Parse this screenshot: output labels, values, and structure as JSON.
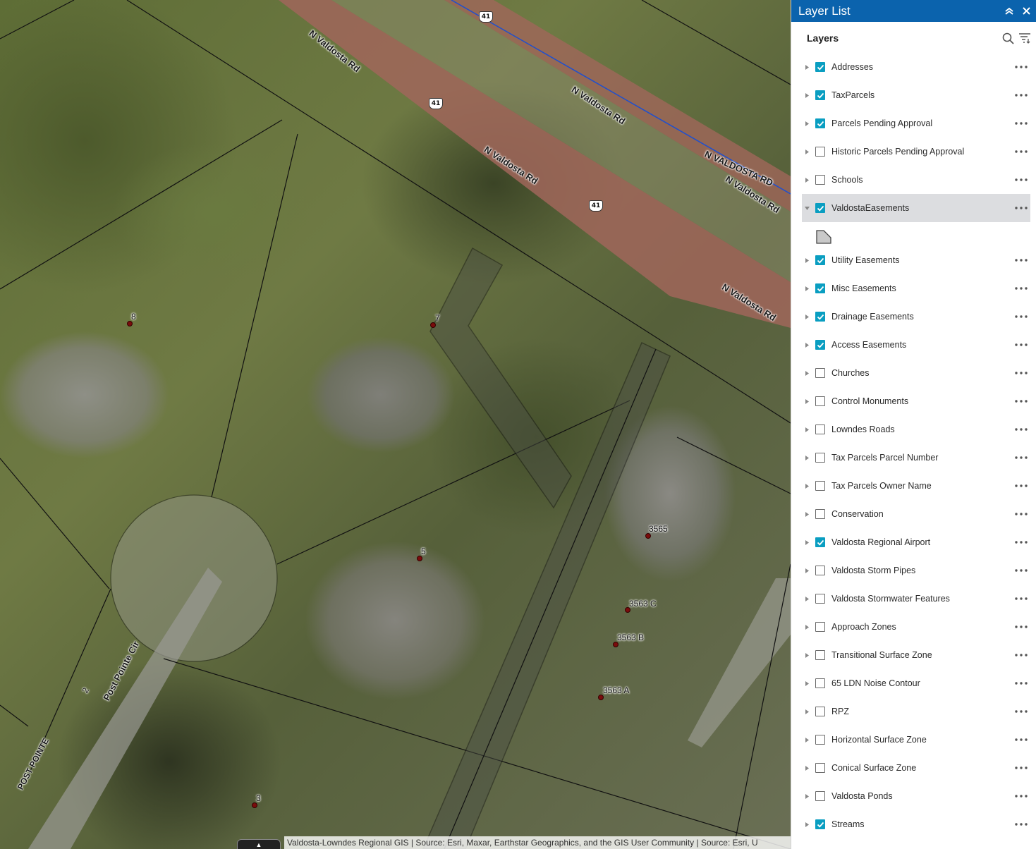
{
  "map": {
    "road_labels": {
      "n_valdosta_rd_1": "N Valdosta Rd",
      "n_valdosta_rd_2": "N Valdosta Rd",
      "n_valdosta_rd_3": "N Valdosta Rd",
      "n_valdosta_rd_4": "N Valdosta Rd",
      "n_valdosta_rd_caps": "N VALDOSTA RD",
      "n_valdosta_rd_5": "N Valdosta Rd",
      "post_pointe_cir": "Post Pointe Cir",
      "post_pointe": "POST POINTE"
    },
    "shields": [
      "41",
      "41",
      "41"
    ],
    "address_points": [
      "8",
      "7",
      "5",
      "3565",
      "3563 C",
      "3563 B",
      "3563 A",
      "3",
      "2"
    ],
    "attribution": "Valdosta-Lowndes Regional GIS | Source: Esri, Maxar, Earthstar Geographics, and the GIS User Community | Source: Esri, U",
    "colors": {
      "road_fill": "#a0665a",
      "parcel_line": "#111111",
      "easement_fill": "#4b4f44",
      "address_point": "#7a0c0c",
      "blue_line": "#1d4fd0"
    }
  },
  "panel": {
    "title": "Layer List",
    "collapse_icon": "double-chevron-up-icon",
    "close_icon": "close-icon",
    "layers_heading": "Layers",
    "search_icon": "search-icon",
    "filter_icon": "filter-icon",
    "accent_color": "#0b63ad",
    "checkbox_color": "#0a9ec1",
    "layers": [
      {
        "name": "Addresses",
        "checked": true
      },
      {
        "name": "TaxParcels",
        "checked": true
      },
      {
        "name": "Parcels Pending Approval",
        "checked": true
      },
      {
        "name": "Historic Parcels Pending Approval",
        "checked": false
      },
      {
        "name": "Schools",
        "checked": false
      },
      {
        "name": "ValdostaEasements",
        "checked": true,
        "expanded": true,
        "selected": true
      },
      {
        "name": "Utility Easements",
        "checked": true
      },
      {
        "name": "Misc Easements",
        "checked": true
      },
      {
        "name": "Drainage Easements",
        "checked": true
      },
      {
        "name": "Access Easements",
        "checked": true
      },
      {
        "name": "Churches",
        "checked": false
      },
      {
        "name": "Control Monuments",
        "checked": false
      },
      {
        "name": "Lowndes Roads",
        "checked": false
      },
      {
        "name": "Tax Parcels Parcel Number",
        "checked": false
      },
      {
        "name": "Tax Parcels Owner Name",
        "checked": false
      },
      {
        "name": "Conservation",
        "checked": false
      },
      {
        "name": "Valdosta Regional Airport",
        "checked": true
      },
      {
        "name": "Valdosta Storm Pipes",
        "checked": false
      },
      {
        "name": "Valdosta Stormwater Features",
        "checked": false
      },
      {
        "name": "Approach Zones",
        "checked": false
      },
      {
        "name": "Transitional Surface Zone",
        "checked": false
      },
      {
        "name": "65 LDN Noise Contour",
        "checked": false
      },
      {
        "name": "RPZ",
        "checked": false
      },
      {
        "name": "Horizontal Surface Zone",
        "checked": false
      },
      {
        "name": "Conical Surface Zone",
        "checked": false
      },
      {
        "name": "Valdosta Ponds",
        "checked": false
      },
      {
        "name": "Streams",
        "checked": true
      }
    ]
  }
}
